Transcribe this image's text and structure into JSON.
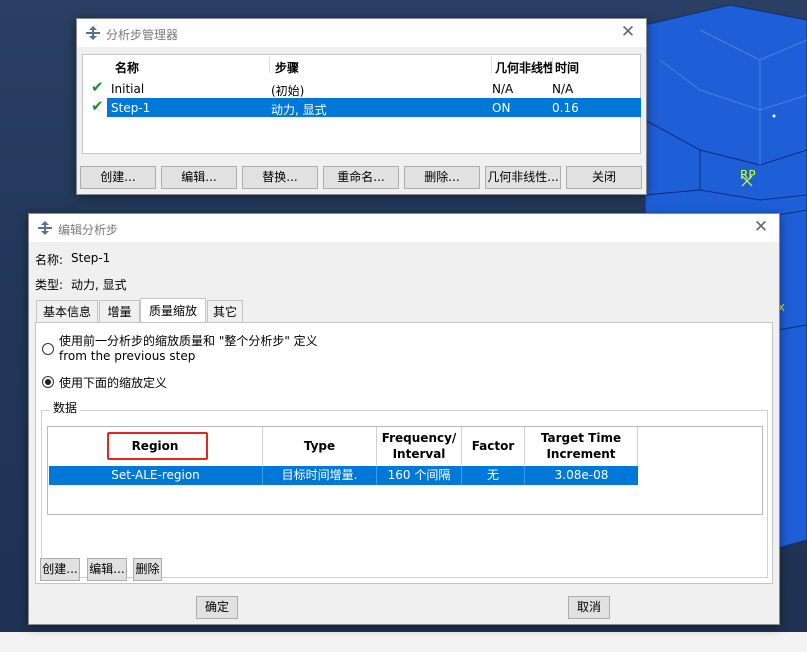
{
  "viewport": {
    "rp_label": "RP",
    "axis_label": "X"
  },
  "step_manager": {
    "title": "分析步管理器",
    "columns": [
      "名称",
      "步骤",
      "几何非线性",
      "时间"
    ],
    "rows": [
      {
        "check": "✔",
        "name": "Initial",
        "procedure": "(初始)",
        "nlgeom": "N/A",
        "time": "N/A",
        "selected": false
      },
      {
        "check": "✔",
        "name": "Step-1",
        "procedure": "动力, 显式",
        "nlgeom": "ON",
        "time": "0.16",
        "selected": true
      }
    ],
    "buttons": [
      "创建...",
      "编辑...",
      "替换...",
      "重命名...",
      "删除...",
      "几何非线性...",
      "关闭"
    ]
  },
  "edit_step": {
    "title": "编辑分析步",
    "name_label": "名称:",
    "name_value": "Step-1",
    "type_label": "类型:",
    "type_value": "动力, 显式",
    "tabs": [
      "基本信息",
      "增量",
      "质量缩放",
      "其它"
    ],
    "active_tab": "质量缩放",
    "option1_line1": "使用前一分析步的缩放质量和 \"整个分析步\" 定义",
    "option1_line2": "from the previous step",
    "option2": "使用下面的缩放定义",
    "option_selected": 2,
    "group_label": "数据",
    "table": {
      "columns": [
        "Region",
        "Type",
        "Frequency/\nInterval",
        "Factor",
        "Target Time\nIncrement"
      ],
      "rows": [
        {
          "region": "Set-ALE-region",
          "type": "目标时间增量.",
          "frequency": "160 个间隔",
          "factor": "无",
          "target": "3.08e-08"
        }
      ]
    },
    "table_buttons": [
      "创建...",
      "编辑...",
      "删除"
    ],
    "ok": "确定",
    "cancel": "取消"
  },
  "colors": {
    "selection": "#0078d7",
    "highlight_box": "#e0281e",
    "viewport_bg": "#24385a",
    "model_blue": "#1e5fd8"
  }
}
